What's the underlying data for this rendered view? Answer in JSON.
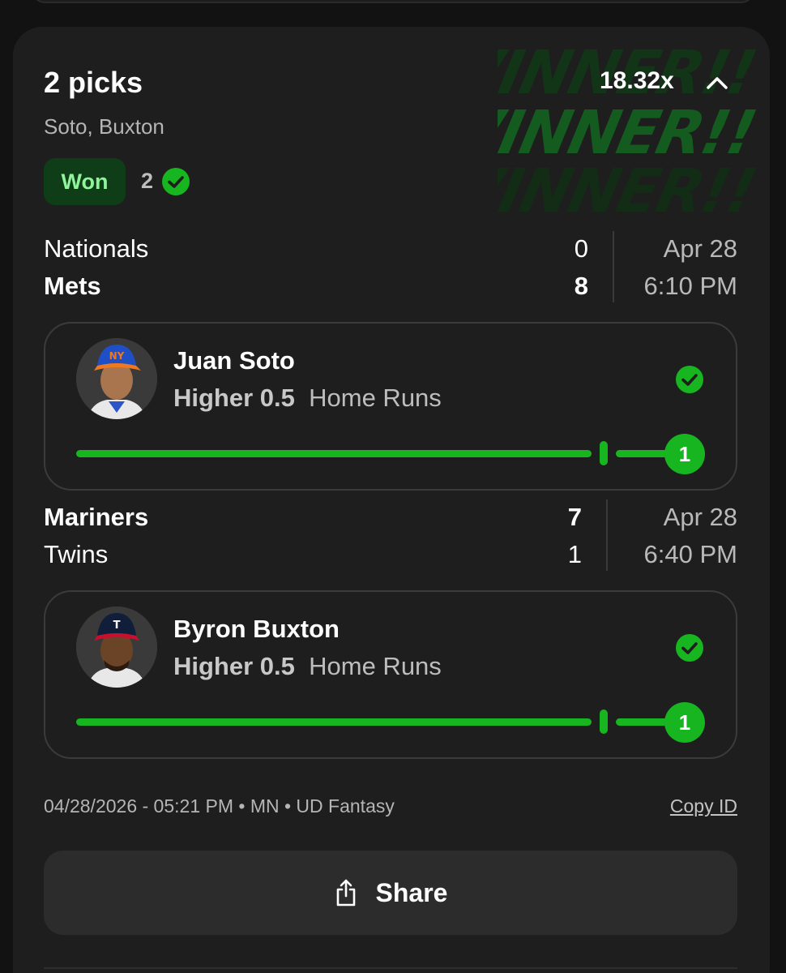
{
  "entry": {
    "title": "2 picks",
    "multiplier": "18.32x",
    "players_summary": "Soto, Buxton",
    "status_label": "Won",
    "correct_count": "2",
    "winner_banner": "WINNER!!"
  },
  "games": [
    {
      "team1": "Nationals",
      "score1": "0",
      "team2": "Mets",
      "score2": "8",
      "date": "Apr 28",
      "time": "6:10 PM"
    },
    {
      "team1": "Mariners",
      "score1": "7",
      "team2": "Twins",
      "score2": "1",
      "date": "Apr 28",
      "time": "6:40 PM"
    }
  ],
  "picks": [
    {
      "player": "Juan Soto",
      "direction": "Higher 0.5",
      "stat": "Home Runs",
      "result_value": "1",
      "progress": 1.0
    },
    {
      "player": "Byron Buxton",
      "direction": "Higher 0.5",
      "stat": "Home Runs",
      "result_value": "1",
      "progress": 1.0
    }
  ],
  "footer": {
    "meta": "04/28/2026 - 05:21 PM • MN • UD Fantasy",
    "copy_id_label": "Copy ID",
    "share_label": "Share"
  },
  "colors": {
    "accent_green": "#17b520",
    "won_badge_bg": "#0f3d17",
    "won_badge_text": "#8ff59a",
    "card_bg": "#1e1e1e"
  }
}
